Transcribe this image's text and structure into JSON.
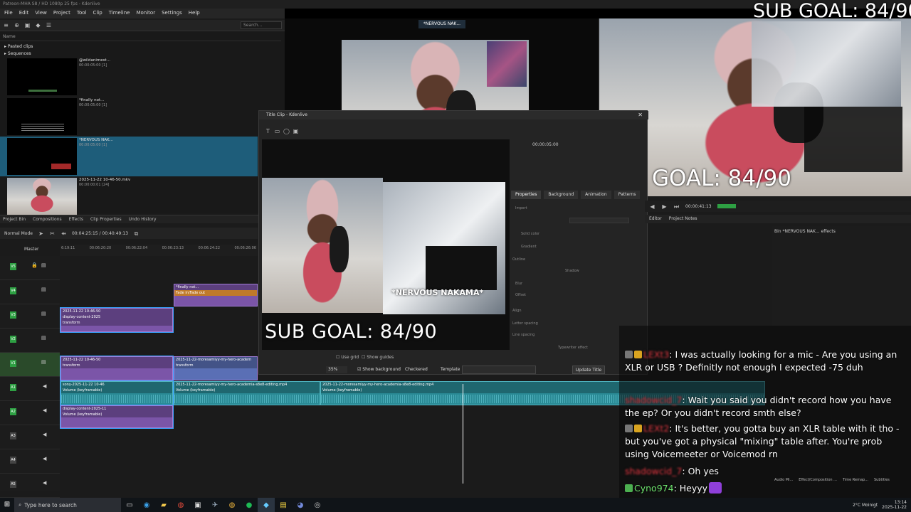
{
  "window": {
    "title": "Patreon-MHA S8 / HD 1080p 25 fps - Kdenlive"
  },
  "menu": [
    "File",
    "Edit",
    "View",
    "Project",
    "Tool",
    "Clip",
    "Timeline",
    "Monitor",
    "Settings",
    "Help"
  ],
  "bin": {
    "search_placeholder": "Search...",
    "header": "Name",
    "folders": [
      "Pasted clips",
      "Sequences"
    ],
    "clips": [
      {
        "name": "@wildanimest...",
        "duration": "00:00:05:00 [1]"
      },
      {
        "name": "*finally not...",
        "duration": "00:00:05:00 [1]"
      },
      {
        "name": "*NERVOUS NAK...",
        "duration": "00:00:05:00 [1]"
      },
      {
        "name": "2025-11-22 10-46-50.mkv",
        "duration": "00:00:00:01 [24]"
      }
    ],
    "tabs": [
      "Project Bin",
      "Compositions",
      "Effects",
      "Clip Properties",
      "Undo History"
    ]
  },
  "timeline": {
    "mode": "Normal Mode",
    "timecode": "00:04:25:15 / 00:40:49:13",
    "master": "Master",
    "ruler": [
      "6:19:11",
      "00:06:20:20",
      "00:06:22:04",
      "00:06:23:13",
      "00:06:24:22",
      "00:06:26:06",
      "00:06:27:15",
      "00:06:28:24"
    ],
    "tracks": [
      "V5",
      "V4",
      "V3",
      "V2",
      "V1",
      "A1",
      "A2",
      "A3",
      "A4",
      "A5"
    ],
    "clips": {
      "fade": "*finally not...",
      "fade_sub": "Fade in/Fade out",
      "v_label": "2025-11-22 10-46-50",
      "display": "display-content-2025",
      "transform": "transform",
      "more": "2025-11-22-moresamiyy-my-hero-academ",
      "audio1": "sony-2025-11-22 10-46",
      "audio_main": "2025-11-22-moresamiyy-my-hero-academia-s8e8-editing.mp4",
      "audio_fx": "Volume (keyframable)",
      "audio2": "display-content-2025-11"
    }
  },
  "monitor": {
    "title_tag": "*NERVOUS NAK...",
    "timecode": "00:00:41:13",
    "tabs": [
      "Editor",
      "Project Notes"
    ],
    "effects_bin": "Bin *NERVOUS NAK... effects"
  },
  "dialog": {
    "title": "Title Clip - Kdenlive",
    "duration": "00:00:05:00",
    "tabs": [
      "Properties",
      "Background",
      "Animation",
      "Patterns"
    ],
    "overlay_text": "*NERVOUS NAKAMA*",
    "sub_goal": "SUB GOAL: 84/90",
    "use_grid": "Use grid",
    "show_guides": "Show guides",
    "zoom": "35%",
    "show_background": "Show background",
    "checkered": "Checkered",
    "template": "Template",
    "update": "Update Title",
    "prop_labels": [
      "Import",
      "Solid color",
      "Gradient",
      "Outline",
      "Shadow",
      "Blur",
      "Offset",
      "Align",
      "Letter spacing",
      "Line spacing",
      "Typewriter effect"
    ]
  },
  "overlays": {
    "goal_top": "SUB GOAL: 84/90",
    "goal_mid": "GOAL: 84/90"
  },
  "chat": [
    {
      "user": "LEXt3",
      "text": "I was actually looking for a mic - Are you using an XLR or USB ? Definitly not enough",
      "tail": "I expected -75 duh"
    },
    {
      "user": "shadowcid_7",
      "text": "Wait you said you didn't record how you have the ep? Or you didn't record smth else?"
    },
    {
      "user": "LEXt2",
      "text": "It's better, you gotta buy an XLR table with it tho - but you've got a physical \"mixing\" table after. You're prob using Voicemeeter or Voicemod rn"
    },
    {
      "user": "shadowcid_7",
      "text": "Oh yes"
    },
    {
      "user": "Cyno974",
      "text": "Heyyy"
    }
  ],
  "taskbar": {
    "search": "Type here to search",
    "weather": "2°C Moinigt",
    "time": "13:14",
    "date": "2025-11-22"
  },
  "status_right": [
    "Audio Mi...",
    "Effect/Composition ...",
    "Time Remap...",
    "Subtitles"
  ],
  "colors": {
    "video_clip": "#7b55a8",
    "audio_clip": "#2a8a95",
    "selection": "#1e5d7a",
    "chat_name": "#e83b45"
  }
}
